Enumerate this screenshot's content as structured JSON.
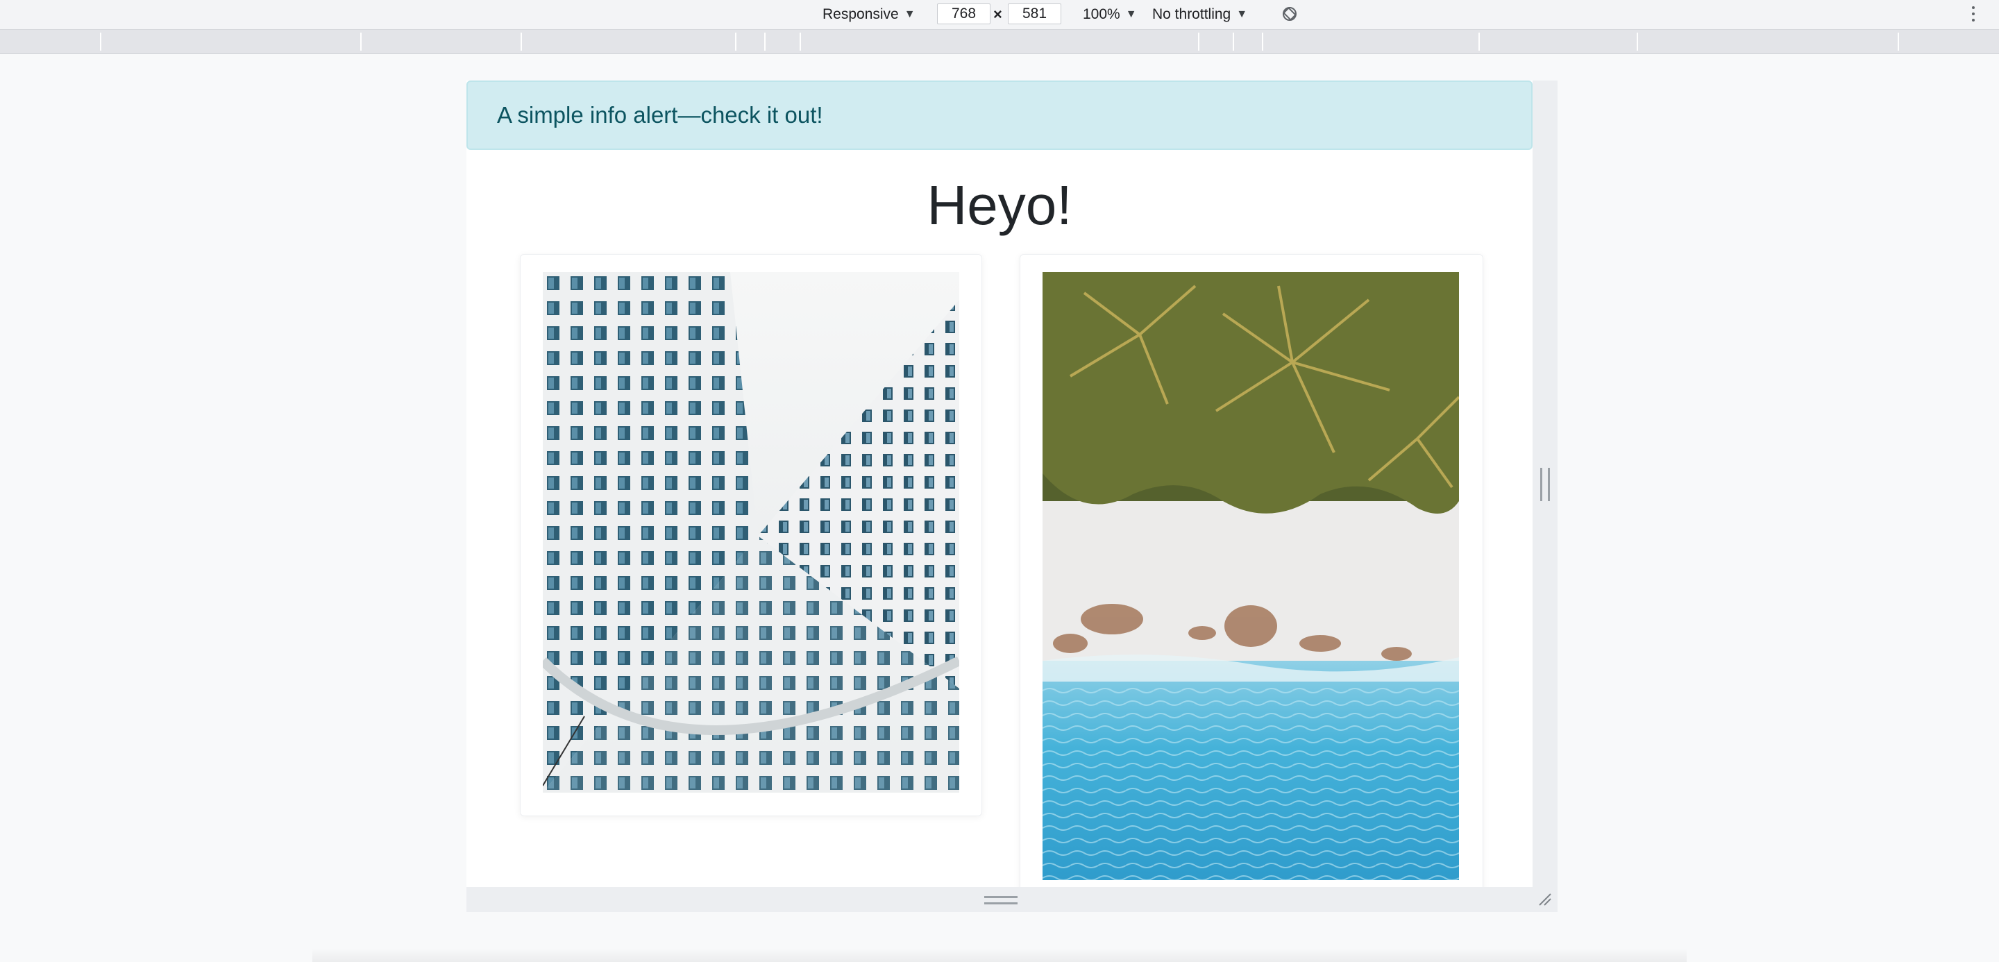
{
  "toolbar": {
    "device_label": "Responsive",
    "width_value": "768",
    "times_symbol": "×",
    "height_value": "581",
    "zoom_label": "100%",
    "throttling_label": "No throttling",
    "caret": "▼",
    "rotate_icon": "rotate-icon",
    "more_icon": "kebab-icon"
  },
  "page": {
    "alert_text": "A simple info alert—check it out!",
    "heading": "Heyo!",
    "images": [
      {
        "subject": "building-facade-photo"
      },
      {
        "subject": "beach-aerial-photo"
      }
    ]
  },
  "colors": {
    "alert_bg": "#d1ecf1",
    "alert_text": "#0c5460",
    "alert_border": "#bee5eb"
  }
}
